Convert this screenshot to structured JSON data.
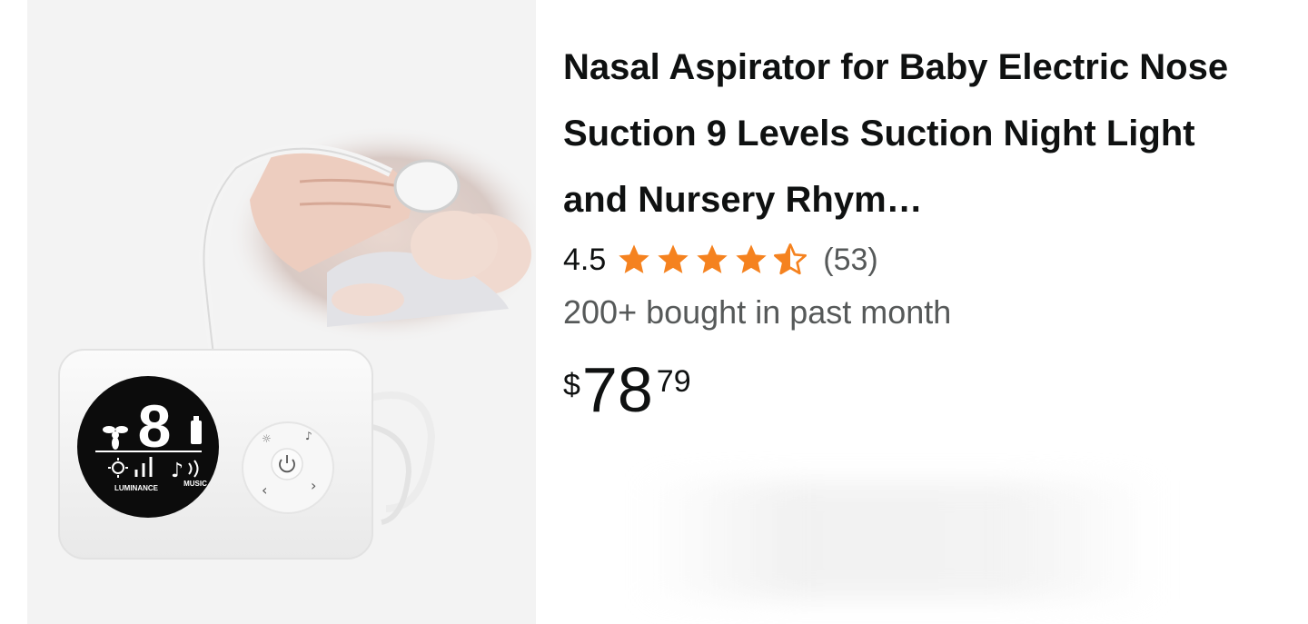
{
  "product": {
    "title": "Nasal Aspirator for Baby Electric Nose Suction 9 Levels Suction Night Light and Nursery Rhym…",
    "rating_value": "4.5",
    "rating": 4.5,
    "review_count": "(53)",
    "bought_text": "200+ bought in past month",
    "price": {
      "symbol": "$",
      "whole": "78",
      "fraction": "79"
    },
    "image": {
      "display_digit": "8",
      "luminance_label": "LUMINANCE",
      "music_label": "MUSIC"
    }
  },
  "colors": {
    "star": "#f5821f",
    "text_primary": "#0f1111",
    "text_secondary": "#565959",
    "image_bg": "#f3f3f3"
  },
  "icons": [
    "star-full-icon",
    "star-half-icon",
    "power-icon",
    "music-note-icon",
    "sun-icon",
    "fan-icon",
    "battery-icon"
  ]
}
